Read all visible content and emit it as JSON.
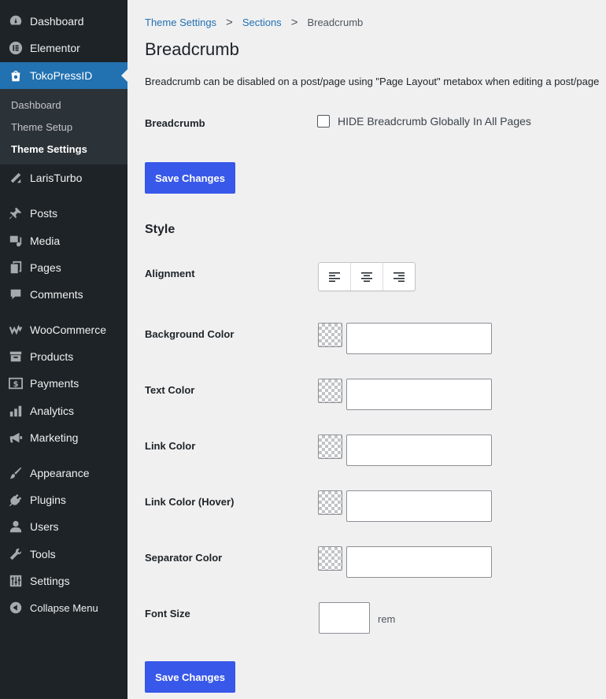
{
  "sidebar": {
    "items": [
      {
        "label": "Dashboard",
        "icon": "dashboard-icon"
      },
      {
        "label": "Elementor",
        "icon": "elementor-icon"
      },
      {
        "label": "TokoPressID",
        "icon": "tokopress-bag-icon"
      },
      {
        "label": "LarisTurbo",
        "icon": "laristurbo-icon"
      },
      {
        "label": "Posts",
        "icon": "pushpin-icon"
      },
      {
        "label": "Media",
        "icon": "media-icon"
      },
      {
        "label": "Pages",
        "icon": "pages-icon"
      },
      {
        "label": "Comments",
        "icon": "comment-icon"
      },
      {
        "label": "WooCommerce",
        "icon": "woocommerce-icon"
      },
      {
        "label": "Products",
        "icon": "archive-icon"
      },
      {
        "label": "Payments",
        "icon": "payment-icon"
      },
      {
        "label": "Analytics",
        "icon": "bar-chart-icon"
      },
      {
        "label": "Marketing",
        "icon": "megaphone-icon"
      },
      {
        "label": "Appearance",
        "icon": "paintbrush-icon"
      },
      {
        "label": "Plugins",
        "icon": "plugin-icon"
      },
      {
        "label": "Users",
        "icon": "user-icon"
      },
      {
        "label": "Tools",
        "icon": "wrench-icon"
      },
      {
        "label": "Settings",
        "icon": "sliders-icon"
      },
      {
        "label": "Collapse Menu",
        "icon": "collapse-arrow-icon"
      }
    ],
    "submenu": [
      "Dashboard",
      "Theme Setup",
      "Theme Settings"
    ],
    "accent": "#2271b1"
  },
  "breadcrumb": {
    "items": [
      "Theme Settings",
      "Sections",
      "Breadcrumb"
    ],
    "separator": ">"
  },
  "page": {
    "title": "Breadcrumb",
    "description": "Breadcrumb can be disabled on a post/page using \"Page Layout\" metabox when editing a post/page"
  },
  "fields": {
    "breadcrumb_label": "Breadcrumb",
    "hide_checkbox_label": "HIDE Breadcrumb Globally In All Pages",
    "save_label": "Save Changes",
    "style_title": "Style",
    "alignment_label": "Alignment",
    "alignment_options": [
      "align-left-icon",
      "align-center-icon",
      "align-right-icon"
    ],
    "colors": [
      {
        "label": "Background Color",
        "value": ""
      },
      {
        "label": "Text Color",
        "value": ""
      },
      {
        "label": "Link Color",
        "value": ""
      },
      {
        "label": "Link Color (Hover)",
        "value": ""
      },
      {
        "label": "Separator Color",
        "value": ""
      }
    ],
    "font_size_label": "Font Size",
    "font_size_value": "",
    "font_size_unit": "rem"
  },
  "colors": {
    "button": "#3858e9",
    "link": "#2271b1",
    "sidebar_bg": "#1d2327"
  }
}
